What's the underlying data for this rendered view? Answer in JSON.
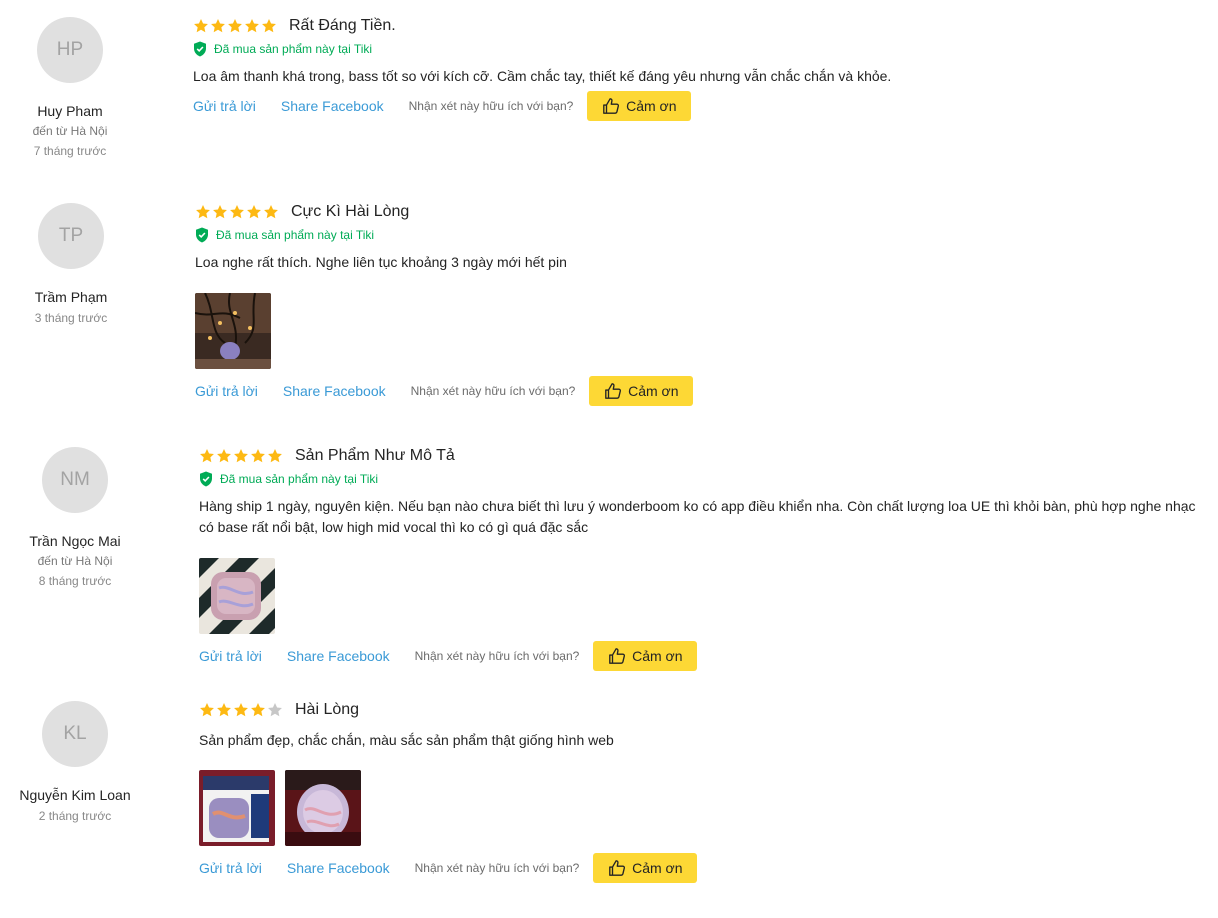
{
  "common": {
    "verified_text": "Đã mua sản phẩm này tại Tiki",
    "reply_label": "Gửi trả lời",
    "share_label": "Share Facebook",
    "helpful_question": "Nhận xét này hữu ích với bạn?",
    "thanks_label": "Cảm ơn",
    "star_color": "#fdb913",
    "star_empty_color": "#c7c7c7"
  },
  "reviews": [
    {
      "initials": "HP",
      "name": "Huy Pham",
      "location": "đến từ Hà Nội",
      "time": "7 tháng trước",
      "rating": 5,
      "title": "Rất Đáng Tiền.",
      "verified": true,
      "content": "Loa âm thanh khá trong, bass tốt so với kích cỡ. Cầm chắc tay, thiết kế đáng yêu nhưng vẫn chắc chắn và khỏe.",
      "images": []
    },
    {
      "initials": "TP",
      "name": "Trầm Phạm",
      "location": "",
      "time": "3 tháng trước",
      "rating": 5,
      "title": "Cực Kì Hài Lòng",
      "verified": true,
      "content": "Loa nghe rất thích. Nghe liên tục khoảng 3 ngày mới hết pin",
      "images": [
        "photo"
      ]
    },
    {
      "initials": "NM",
      "name": "Trần Ngọc Mai",
      "location": "đến từ Hà Nội",
      "time": "8 tháng trước",
      "rating": 5,
      "title": "Sản Phẩm Như Mô Tả",
      "verified": true,
      "content": "Hàng ship 1 ngày, nguyên kiện. Nếu bạn nào chưa biết thì lưu ý wonderboom ko có app điều khiển nha. Còn chất lượng loa UE thì khỏi bàn, phù hợp nghe nhạc có base rất nổi bật, low high mid vocal thì ko có gì quá đặc sắc",
      "images": [
        "photo"
      ]
    },
    {
      "initials": "KL",
      "name": "Nguyễn Kim Loan",
      "location": "",
      "time": "2 tháng trước",
      "rating": 4,
      "title": "Hài Lòng",
      "verified": false,
      "content": "Sản phẩm đẹp, chắc chắn, màu sắc sản phẩm thật giống hình web",
      "images": [
        "photo",
        "photo"
      ]
    }
  ]
}
